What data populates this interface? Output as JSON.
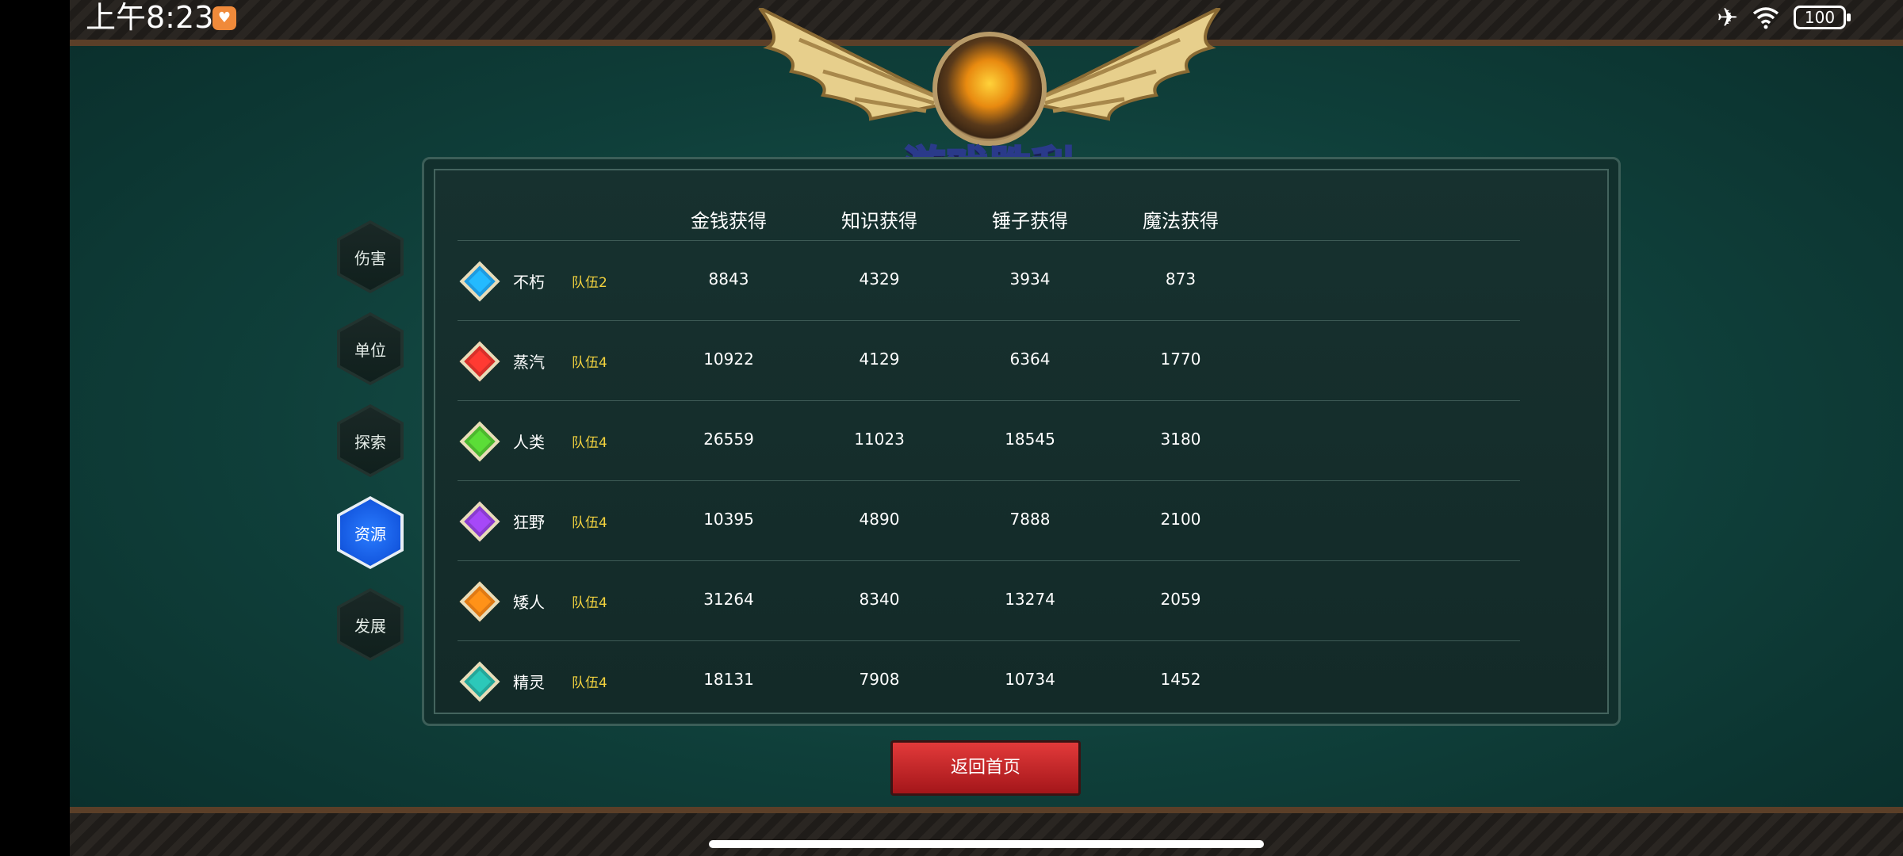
{
  "status_bar": {
    "time": "上午8:23",
    "battery": "100"
  },
  "title": "游戏胜利",
  "side_tabs": [
    {
      "label": "伤害",
      "active": false
    },
    {
      "label": "单位",
      "active": false
    },
    {
      "label": "探索",
      "active": false
    },
    {
      "label": "资源",
      "active": true
    },
    {
      "label": "发展",
      "active": false
    }
  ],
  "table": {
    "headers": [
      "金钱获得",
      "知识获得",
      "锤子获得",
      "魔法获得"
    ],
    "rows": [
      {
        "name": "不朽",
        "team": "队伍2",
        "gem_color": "#1e9be0",
        "values": [
          "8843",
          "4329",
          "3934",
          "873"
        ]
      },
      {
        "name": "蒸汽",
        "team": "队伍4",
        "gem_color": "#d8302a",
        "values": [
          "10922",
          "4129",
          "6364",
          "1770"
        ]
      },
      {
        "name": "人类",
        "team": "队伍4",
        "gem_color": "#4cb82e",
        "values": [
          "26559",
          "11023",
          "18545",
          "3180"
        ]
      },
      {
        "name": "狂野",
        "team": "队伍4",
        "gem_color": "#8a3ccf",
        "values": [
          "10395",
          "4890",
          "7888",
          "2100"
        ]
      },
      {
        "name": "矮人",
        "team": "队伍4",
        "gem_color": "#e07a14",
        "values": [
          "31264",
          "8340",
          "13274",
          "2059"
        ]
      },
      {
        "name": "精灵",
        "team": "队伍4",
        "gem_color": "#25a79a",
        "values": [
          "18131",
          "7908",
          "10734",
          "1452"
        ]
      }
    ]
  },
  "back_button": "返回首页",
  "colors": {
    "background": "#0f3f3a",
    "team": "#f3d23e",
    "active_tab": "#1458e0",
    "back_button": "#c8262a"
  }
}
